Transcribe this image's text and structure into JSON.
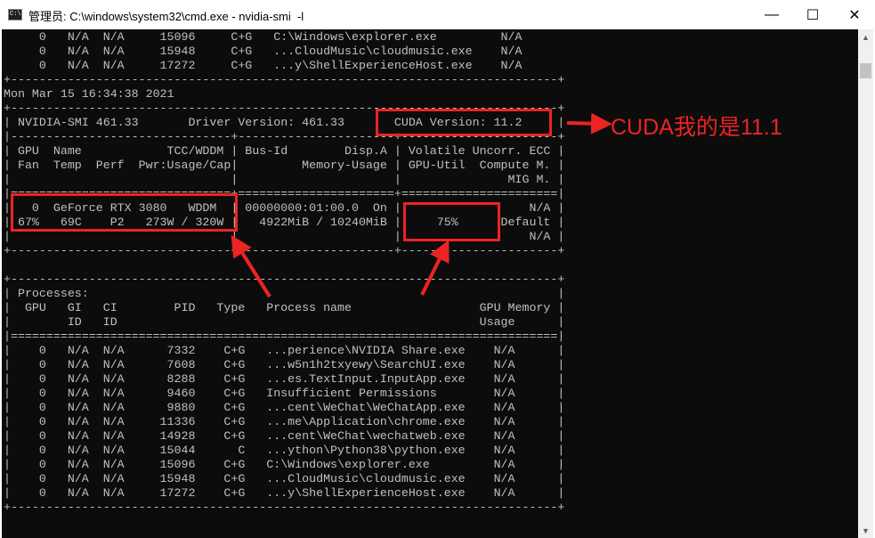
{
  "window": {
    "title": "管理员: C:\\windows\\system32\\cmd.exe - nvidia-smi  -l",
    "icon_text": "C:\\",
    "icon": "cmd-icon",
    "controls": [
      "minimize-icon",
      "maximize-icon",
      "close-icon"
    ],
    "minimize_glyph": "—",
    "maximize_glyph": "☐",
    "close_glyph": "✕"
  },
  "console": {
    "lines": [
      "     0   N/A  N/A     15096     C+G   C:\\Windows\\explorer.exe         N/A",
      "     0   N/A  N/A     15948     C+G   ...CloudMusic\\cloudmusic.exe    N/A",
      "     0   N/A  N/A     17272     C+G   ...y\\ShellExperienceHost.exe    N/A",
      "+-----------------------------------------------------------------------------+",
      "Mon Mar 15 16:34:38 2021",
      "+-----------------------------------------------------------------------------+",
      "| NVIDIA-SMI 461.33       Driver Version: 461.33       CUDA Version: 11.2     |",
      "|-------------------------------+----------------------+----------------------+",
      "| GPU  Name            TCC/WDDM | Bus-Id        Disp.A | Volatile Uncorr. ECC |",
      "| Fan  Temp  Perf  Pwr:Usage/Cap|         Memory-Usage | GPU-Util  Compute M. |",
      "|                               |                      |               MIG M. |",
      "|===============================+======================+======================|",
      "|   0  GeForce RTX 3080   WDDM  | 00000000:01:00.0  On |                  N/A |",
      "| 67%   69C    P2   273W / 320W |   4922MiB / 10240MiB |     75%      Default |",
      "|                               |                      |                  N/A |",
      "+-------------------------------+----------------------+----------------------+",
      "",
      "+-----------------------------------------------------------------------------+",
      "| Processes:                                                                  |",
      "|  GPU   GI   CI        PID   Type   Process name                  GPU Memory |",
      "|        ID   ID                                                   Usage      |",
      "|=============================================================================|",
      "|    0   N/A  N/A      7332    C+G   ...perience\\NVIDIA Share.exe    N/A      |",
      "|    0   N/A  N/A      7608    C+G   ...w5n1h2txyewy\\SearchUI.exe    N/A      |",
      "|    0   N/A  N/A      8288    C+G   ...es.TextInput.InputApp.exe    N/A      |",
      "|    0   N/A  N/A      9460    C+G   Insufficient Permissions        N/A      |",
      "|    0   N/A  N/A      9880    C+G   ...cent\\WeChat\\WeChatApp.exe    N/A      |",
      "|    0   N/A  N/A     11336    C+G   ...me\\Application\\chrome.exe    N/A      |",
      "|    0   N/A  N/A     14928    C+G   ...cent\\WeChat\\wechatweb.exe    N/A      |",
      "|    0   N/A  N/A     15044      C   ...ython\\Python38\\python.exe    N/A      |",
      "|    0   N/A  N/A     15096    C+G   C:\\Windows\\explorer.exe         N/A      |",
      "|    0   N/A  N/A     15948    C+G   ...CloudMusic\\cloudmusic.exe    N/A      |",
      "|    0   N/A  N/A     17272    C+G   ...y\\ShellExperienceHost.exe    N/A      |",
      "+-----------------------------------------------------------------------------+"
    ]
  },
  "annotation": {
    "text": "CUDA我的是11.1",
    "color": "#ed2323"
  },
  "scrollbar": {
    "up_glyph": "▲",
    "down_glyph": "▼"
  },
  "colors": {
    "console_bg": "#0c0c0c",
    "console_fg": "#c0c0c0",
    "highlight": "#ed2323"
  }
}
